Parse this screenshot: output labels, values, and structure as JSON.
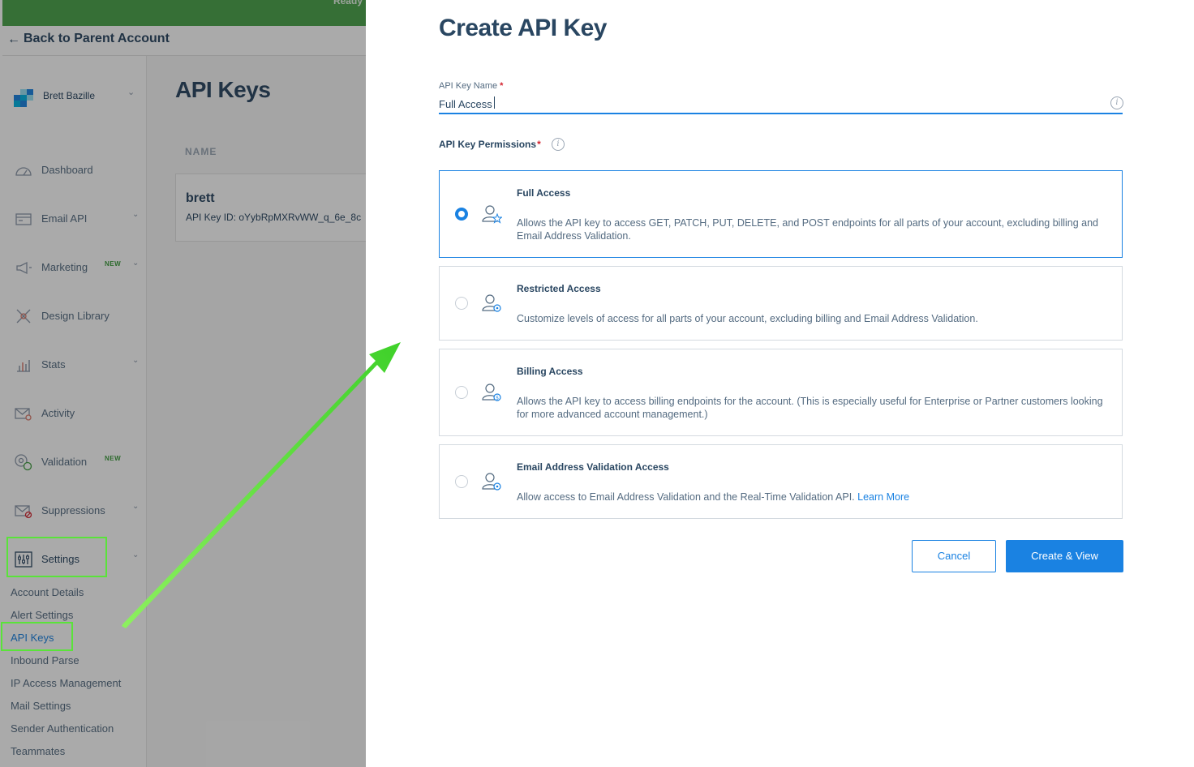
{
  "topbar": {
    "status": "Ready"
  },
  "back": {
    "label": "Back to Parent Account"
  },
  "user": {
    "name": "Brett Bazille"
  },
  "sidebar": {
    "items": [
      {
        "label": "Dashboard",
        "badge": ""
      },
      {
        "label": "Email API",
        "badge": ""
      },
      {
        "label": "Marketing",
        "badge": "NEW"
      },
      {
        "label": "Design Library",
        "badge": ""
      },
      {
        "label": "Stats",
        "badge": ""
      },
      {
        "label": "Activity",
        "badge": ""
      },
      {
        "label": "Validation",
        "badge": "NEW"
      },
      {
        "label": "Suppressions",
        "badge": ""
      },
      {
        "label": "Settings",
        "badge": ""
      }
    ],
    "settings_sub": [
      "Account Details",
      "Alert Settings",
      "API Keys",
      "Inbound Parse",
      "IP Access Management",
      "Mail Settings",
      "Sender Authentication",
      "Teammates"
    ]
  },
  "main": {
    "title": "API Keys",
    "column_header": "NAME",
    "key": {
      "name": "brett",
      "id_text": "API Key ID: oYybRpMXRvWW_q_6e_8c"
    }
  },
  "modal": {
    "title": "Create API Key",
    "name_label": "API Key Name",
    "name_value": "Full Access",
    "required_mark": "*",
    "permissions_label": "API Key Permissions",
    "options": [
      {
        "title": "Full Access",
        "desc": "Allows the API key to access GET, PATCH, PUT, DELETE, and POST endpoints for all parts of your account, excluding billing and Email Address Validation.",
        "selected": true
      },
      {
        "title": "Restricted Access",
        "desc": "Customize levels of access for all parts of your account, excluding billing and Email Address Validation.",
        "selected": false
      },
      {
        "title": "Billing Access",
        "desc": "Allows the API key to access billing endpoints for the account. (This is especially useful for Enterprise or Partner customers looking for more advanced account management.)",
        "selected": false
      },
      {
        "title": "Email Address Validation Access",
        "desc": "Allow access to Email Address Validation and the Real-Time Validation API.",
        "link": "Learn More",
        "selected": false
      }
    ],
    "cancel_label": "Cancel",
    "create_label": "Create & View"
  },
  "colors": {
    "accent": "#1a82e2",
    "navy": "#294661",
    "highlight": "#5ae33a",
    "topbar": "#4aa34a"
  }
}
